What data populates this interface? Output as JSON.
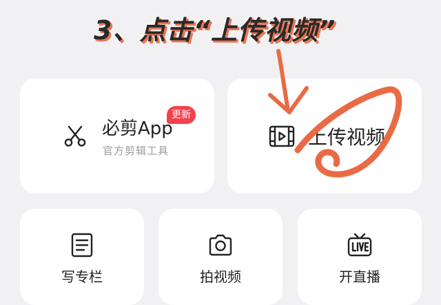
{
  "annotation": {
    "title": "3、点击“上传视频”"
  },
  "cards": {
    "jianji": {
      "name": "必剪App",
      "subtitle": "官方剪辑工具",
      "badge": "更新",
      "icon": "scissors-icon"
    },
    "upload": {
      "label": "上传视频",
      "icon": "video-file-icon"
    },
    "column": {
      "label": "写专栏",
      "icon": "document-icon"
    },
    "shoot": {
      "label": "拍视频",
      "icon": "camera-icon"
    },
    "live": {
      "label": "开直播",
      "icon": "live-tv-icon"
    }
  },
  "colors": {
    "badge": "#f4414b",
    "annotation_stroke": "#e96b45",
    "background": "#f1f1f3",
    "card": "#ffffff"
  }
}
